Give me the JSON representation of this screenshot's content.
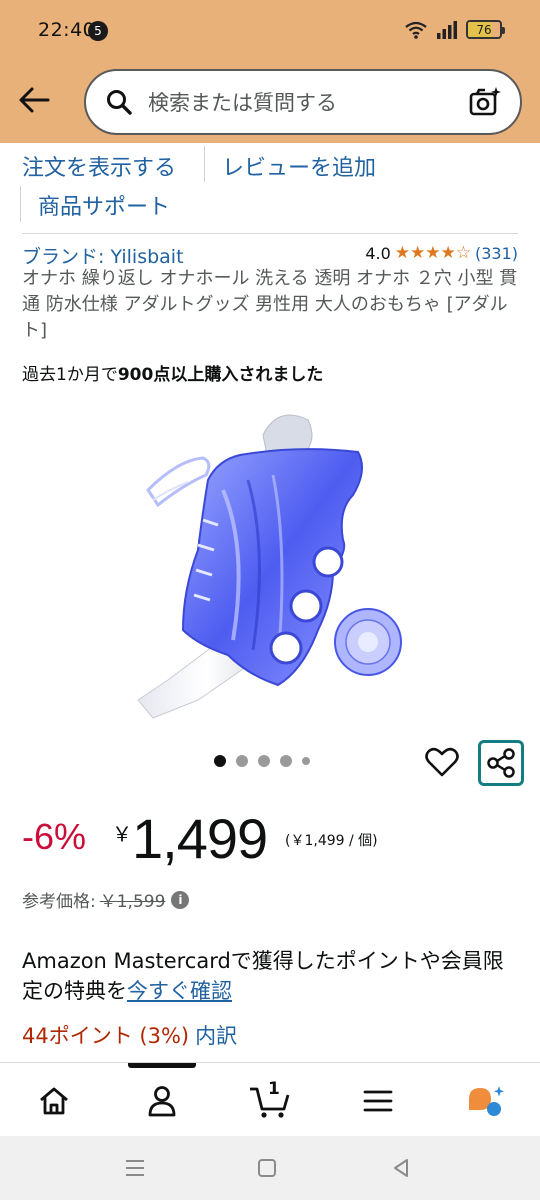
{
  "status_bar": {
    "time": "22:40",
    "notification_count": "5",
    "battery": "76"
  },
  "search": {
    "placeholder": "検索または質問する"
  },
  "actions": {
    "view_orders": "注文を表示する",
    "add_review": "レビューを追加",
    "product_support": "商品サポート"
  },
  "product": {
    "brand": "ブランド: Yilisbait",
    "rating_value": "4.0",
    "stars": "★★★★☆",
    "rating_count": "(331)",
    "title": "オナホ 繰り返し オナホール 洗える 透明 オナホ ２穴 小型 貫通 防水仕様 アダルトグッズ 男性用 大人のおもちゃ [アダルト]",
    "purchase_prefix": "過去1か月で",
    "purchase_count": "900点以上購入されました",
    "image_count": 5,
    "active_image_index": 0
  },
  "price": {
    "discount": "-6%",
    "currency": "￥",
    "amount": "1,499",
    "unit_price": "(￥1,499 / 個)",
    "reference_label": "参考価格:",
    "reference_value": "￥1,599",
    "info_glyph": "i"
  },
  "promo": {
    "text": "Amazon Mastercardで獲得したポイントや会員限定の特典を",
    "link": "今すぐ確認"
  },
  "points": {
    "text": "44ポイント (3%)",
    "breakdown": "内訳"
  },
  "bottom_nav": {
    "items": [
      "home",
      "account",
      "cart",
      "menu",
      "rufus"
    ],
    "cart_count": "1"
  },
  "colors": {
    "header": "#e9b17a",
    "link": "#2162a1",
    "discount": "#cc0c39",
    "star": "#de7921",
    "share_border": "#127d82",
    "points": "#b12704"
  }
}
